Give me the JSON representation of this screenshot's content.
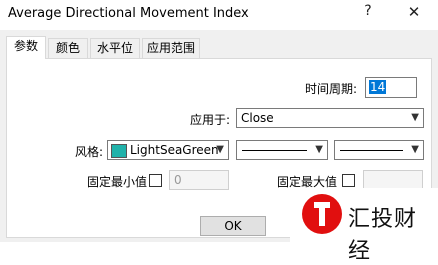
{
  "window": {
    "title": "Average Directional Movement Index",
    "help_glyph": "?",
    "close_glyph": "✕"
  },
  "tabs": [
    {
      "label": "参数"
    },
    {
      "label": "颜色"
    },
    {
      "label": "水平位"
    },
    {
      "label": "应用范围"
    }
  ],
  "params": {
    "period_label": "时间周期:",
    "period_value": "14",
    "apply_label": "应用于:",
    "apply_value": "Close",
    "style_label": "风格:",
    "color_name": "LightSeaGreen",
    "color_hex": "#20b2aa",
    "fixed_min_label": "固定最小值",
    "fixed_min_value": "0",
    "fixed_max_label_partial": "固定最大值"
  },
  "buttons": {
    "ok": "OK"
  },
  "watermark": {
    "text": "汇投财经"
  }
}
